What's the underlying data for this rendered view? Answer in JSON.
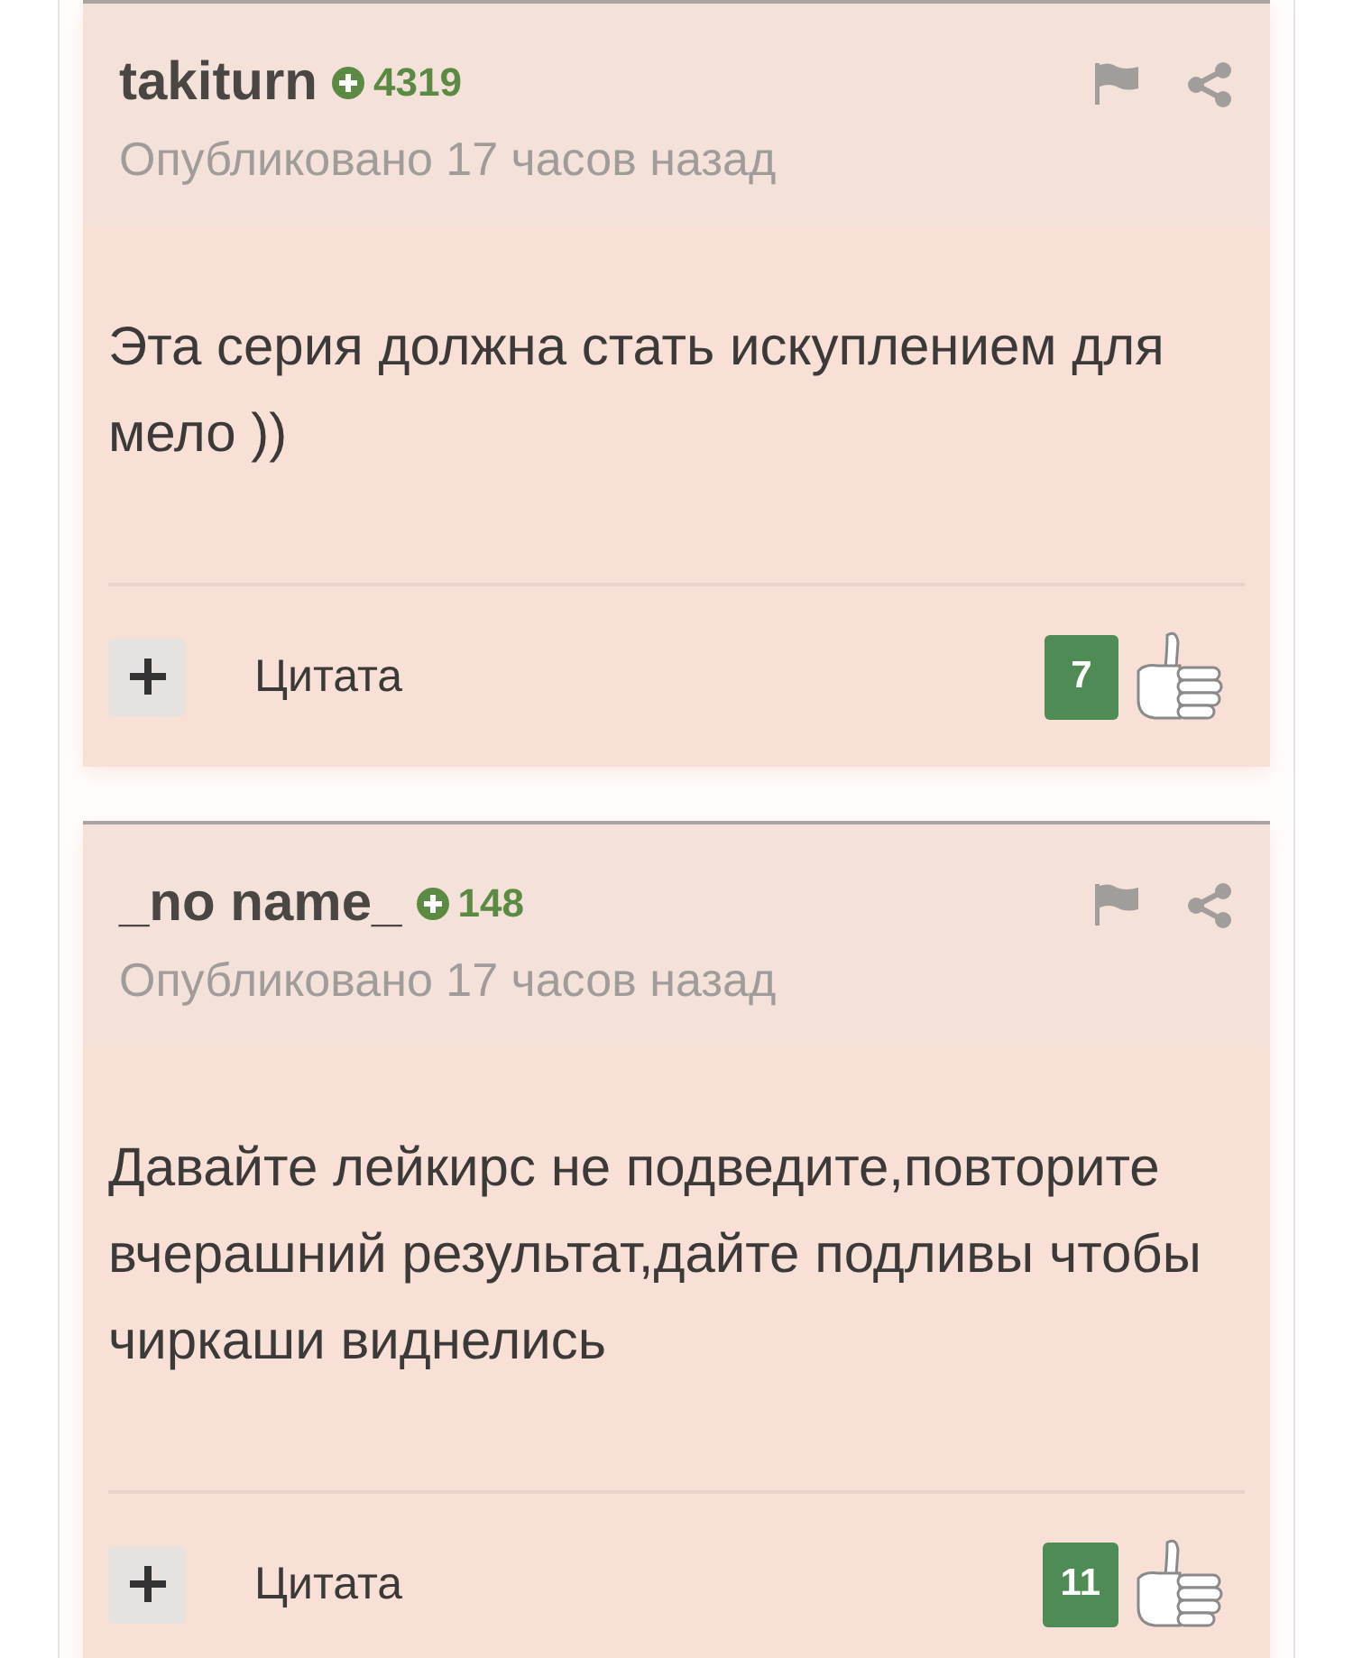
{
  "comments": [
    {
      "author": "takiturn",
      "rating": "4319",
      "posted": "Опубликовано 17 часов назад",
      "text": "Эта серия должна стать искуплением для мело ))",
      "quote_label": "Цитата",
      "votes": "7"
    },
    {
      "author": "_no name_",
      "rating": "148",
      "posted": "Опубликовано 17 часов назад",
      "text": "Давайте лейкирс не подведите,повторите вчерашний результат,дайте подливы чтобы чиркаши виднелись",
      "quote_label": "Цитата",
      "votes": "11"
    }
  ]
}
